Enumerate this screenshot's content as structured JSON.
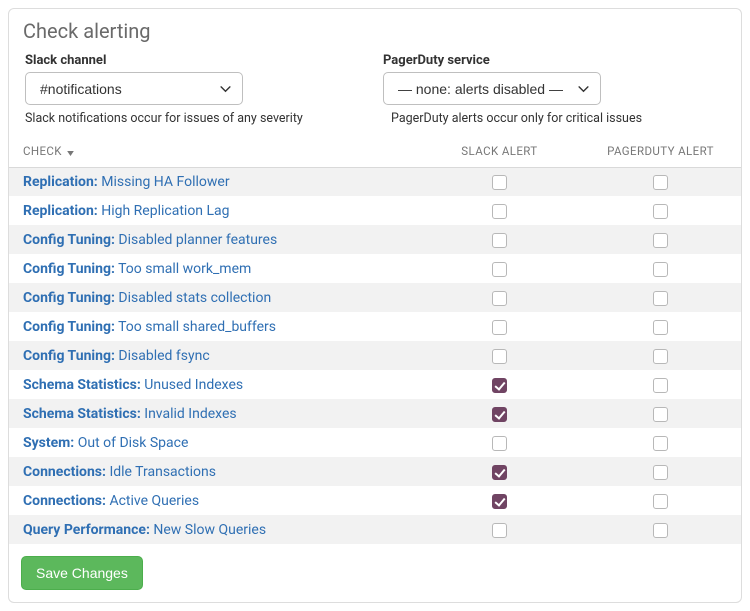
{
  "panel_title": "Check alerting",
  "form": {
    "slack_label": "Slack channel",
    "slack_value": "#notifications",
    "slack_help": "Slack notifications occur for issues of any severity",
    "pagerduty_label": "PagerDuty service",
    "pagerduty_value": "— none: alerts disabled —",
    "pagerduty_help": "PagerDuty alerts occur only for critical issues"
  },
  "columns": {
    "check": "Check",
    "slack": "Slack Alert",
    "pagerduty": "PagerDuty Alert"
  },
  "rows": [
    {
      "category": "Replication:",
      "name": "Missing HA Follower",
      "slack": false,
      "pagerduty": false
    },
    {
      "category": "Replication:",
      "name": "High Replication Lag",
      "slack": false,
      "pagerduty": false
    },
    {
      "category": "Config Tuning:",
      "name": "Disabled planner features",
      "slack": false,
      "pagerduty": false
    },
    {
      "category": "Config Tuning:",
      "name": "Too small work_mem",
      "slack": false,
      "pagerduty": false
    },
    {
      "category": "Config Tuning:",
      "name": "Disabled stats collection",
      "slack": false,
      "pagerduty": false
    },
    {
      "category": "Config Tuning:",
      "name": "Too small shared_buffers",
      "slack": false,
      "pagerduty": false
    },
    {
      "category": "Config Tuning:",
      "name": "Disabled fsync",
      "slack": false,
      "pagerduty": false
    },
    {
      "category": "Schema Statistics:",
      "name": "Unused Indexes",
      "slack": true,
      "pagerduty": false
    },
    {
      "category": "Schema Statistics:",
      "name": "Invalid Indexes",
      "slack": true,
      "pagerduty": false
    },
    {
      "category": "System:",
      "name": "Out of Disk Space",
      "slack": false,
      "pagerduty": false
    },
    {
      "category": "Connections:",
      "name": "Idle Transactions",
      "slack": true,
      "pagerduty": false
    },
    {
      "category": "Connections:",
      "name": "Active Queries",
      "slack": true,
      "pagerduty": false
    },
    {
      "category": "Query Performance:",
      "name": "New Slow Queries",
      "slack": false,
      "pagerduty": false
    }
  ],
  "save_label": "Save Changes"
}
